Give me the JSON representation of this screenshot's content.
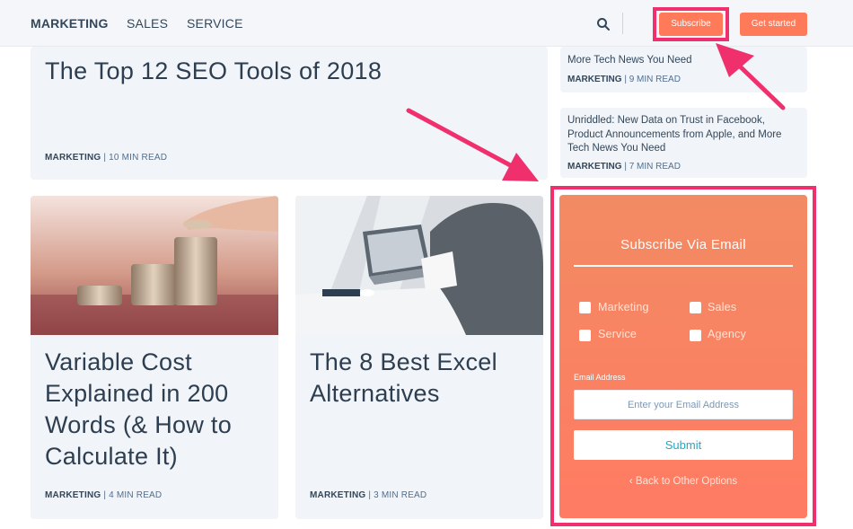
{
  "nav": {
    "links": [
      "MARKETING",
      "SALES",
      "SERVICE"
    ],
    "search_icon": "search-icon",
    "subscribe_label": "Subscribe",
    "get_started_label": "Get started"
  },
  "featured": {
    "title": "The Top 12 SEO Tools of 2018",
    "tag": "MARKETING",
    "read_time": "| 10 MIN READ"
  },
  "sidebar_posts": [
    {
      "title": "More Tech News You Need",
      "tag": "MARKETING",
      "read_time": "| 9 MIN READ"
    },
    {
      "title": "Unriddled: New Data on Trust in Facebook, Product Announcements from Apple, and More Tech News You Need",
      "tag": "MARKETING",
      "read_time": "| 7 MIN READ"
    }
  ],
  "articles": [
    {
      "title": "Variable Cost Explained in 200 Words (& How to Calculate It)",
      "tag": "MARKETING",
      "read_time": "| 4 MIN READ",
      "image": "coins-stack-image"
    },
    {
      "title": "The 8 Best Excel Alternatives",
      "tag": "MARKETING",
      "read_time": "| 3 MIN READ",
      "image": "laptop-desk-image"
    }
  ],
  "subscribe_panel": {
    "title": "Subscribe Via Email",
    "options": [
      "Marketing",
      "Sales",
      "Service",
      "Agency"
    ],
    "email_label": "Email Address",
    "email_placeholder": "Enter your Email Address",
    "submit_label": "Submit",
    "back_label": "‹ Back to Other Options"
  },
  "colors": {
    "accent": "#ff7a59",
    "highlight": "#f0306d",
    "card_bg": "#f1f4f8",
    "text": "#33475b"
  }
}
